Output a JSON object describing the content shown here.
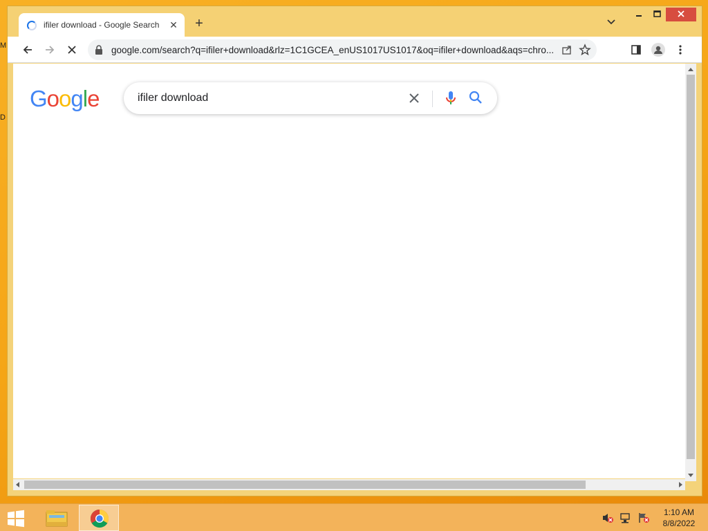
{
  "desktop": {
    "edge_letters": [
      "M",
      "D"
    ]
  },
  "browser": {
    "tab": {
      "title": "ifiler download - Google Search",
      "close_label": "✕"
    },
    "new_tab_label": "+",
    "omnibox": {
      "url": "google.com/search?q=ifiler+download&rlz=1C1GCEA_enUS1017US1017&oq=ifiler+download&aqs=chro..."
    }
  },
  "page": {
    "logo_letters": [
      {
        "char": "G",
        "color": "#4285F4"
      },
      {
        "char": "o",
        "color": "#EA4335"
      },
      {
        "char": "o",
        "color": "#FBBC05"
      },
      {
        "char": "g",
        "color": "#4285F4"
      },
      {
        "char": "l",
        "color": "#34A853"
      },
      {
        "char": "e",
        "color": "#EA4335"
      }
    ],
    "search": {
      "value": "ifiler download"
    }
  },
  "taskbar": {
    "clock": {
      "time": "1:10 AM",
      "date": "8/8/2022"
    }
  },
  "colors": {
    "accent_blue": "#1a73e8",
    "close_red": "#d74d3f",
    "frame": "#f5d174"
  }
}
